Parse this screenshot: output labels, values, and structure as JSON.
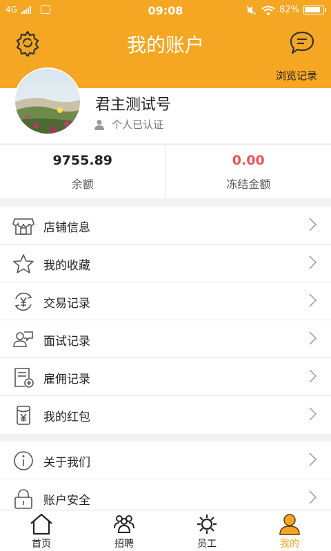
{
  "status": {
    "network": "4G",
    "time": "09:08",
    "battery": "82%"
  },
  "header": {
    "title": "我的账户",
    "history_label": "浏览记录"
  },
  "profile": {
    "name": "君主测试号",
    "verify_text": "个人已认证"
  },
  "balances": [
    {
      "value": "9755.89",
      "label": "余额",
      "color": "#222222"
    },
    {
      "value": "0.00",
      "label": "冻结金额",
      "color": "#e8545a"
    }
  ],
  "menu_group1": [
    {
      "label": "店铺信息",
      "icon": "store-icon"
    },
    {
      "label": "我的收藏",
      "icon": "star-icon"
    },
    {
      "label": "交易记录",
      "icon": "yen-cycle-icon"
    },
    {
      "label": "面试记录",
      "icon": "people-chat-icon"
    },
    {
      "label": "雇佣记录",
      "icon": "document-add-icon"
    },
    {
      "label": "我的红包",
      "icon": "red-envelope-icon"
    }
  ],
  "menu_group2": [
    {
      "label": "关于我们",
      "icon": "info-icon"
    },
    {
      "label": "账户安全",
      "icon": "lock-icon"
    }
  ],
  "tabs": [
    {
      "label": "首页",
      "icon": "home-icon"
    },
    {
      "label": "招聘",
      "icon": "recruit-icon"
    },
    {
      "label": "员工",
      "icon": "staff-gear-icon"
    },
    {
      "label": "我的",
      "icon": "user-icon",
      "active": true
    }
  ],
  "colors": {
    "accent": "#f5a623",
    "frozen": "#e8545a"
  }
}
